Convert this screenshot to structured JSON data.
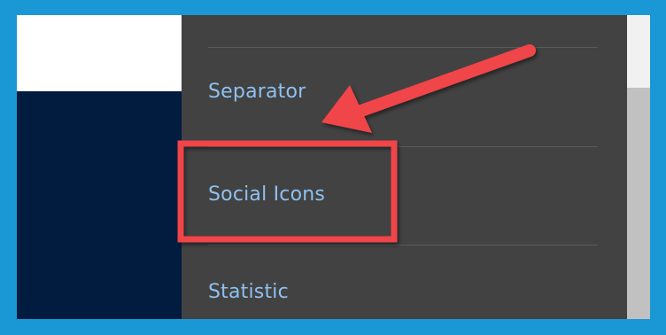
{
  "menu": {
    "items": [
      {
        "label": "Separator"
      },
      {
        "label": "Social Icons"
      },
      {
        "label": "Statistic"
      }
    ]
  },
  "annotation": {
    "highlight_color": "#f04449",
    "frame_color": "#1a98d5",
    "arrow_target": "Social Icons"
  },
  "colors": {
    "panel_background": "#424242",
    "menu_text": "#8ec1f0",
    "sidebar_navy": "#011c3f"
  }
}
